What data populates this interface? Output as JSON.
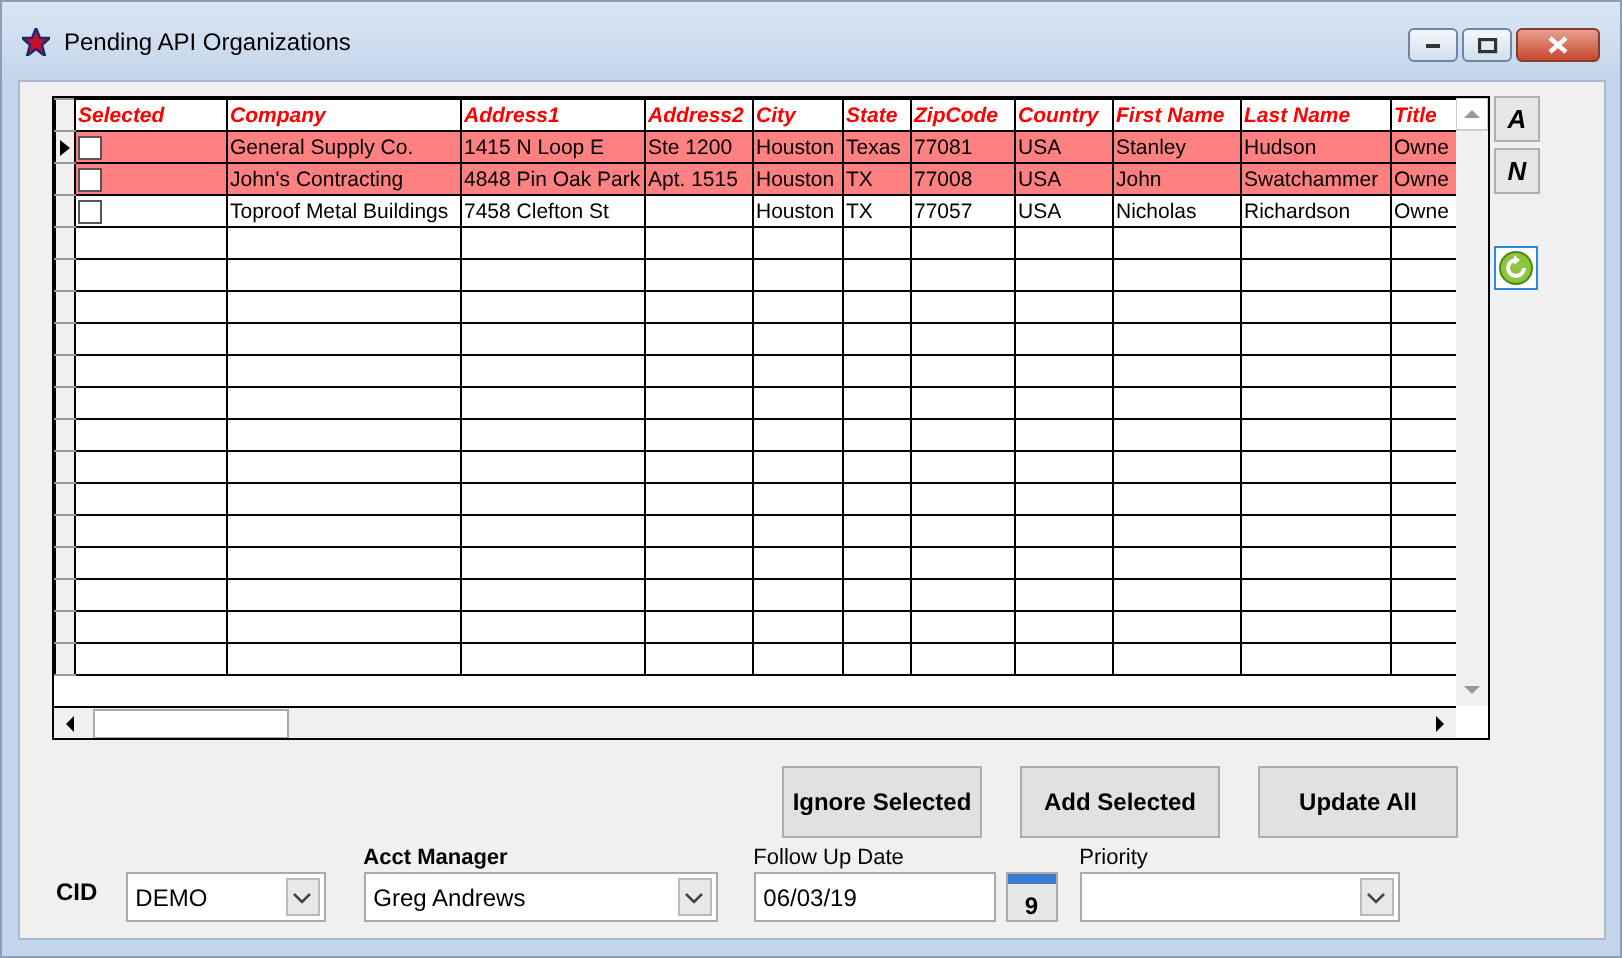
{
  "window": {
    "title": "Pending API Organizations"
  },
  "grid": {
    "checkbox_column": "Selected",
    "columns": [
      "Company",
      "Address1",
      "Address2",
      "City",
      "State",
      "ZipCode",
      "Country",
      "First Name",
      "Last Name",
      "Title"
    ],
    "rows": [
      {
        "current": true,
        "highlighted": true,
        "checked": false,
        "cells": [
          "General Supply Co.",
          "1415 N Loop E",
          "Ste 1200",
          "Houston",
          "Texas",
          "77081",
          "USA",
          "Stanley",
          "Hudson",
          "Owne"
        ]
      },
      {
        "current": false,
        "highlighted": true,
        "checked": false,
        "cells": [
          "John's Contracting",
          "4848 Pin Oak Park",
          "Apt. 1515",
          "Houston",
          "TX",
          "77008",
          "USA",
          "John",
          "Swatchammer",
          "Owne"
        ]
      },
      {
        "current": false,
        "highlighted": false,
        "checked": false,
        "cells": [
          "Toproof Metal Buildings",
          "7458 Clefton St",
          "",
          "Houston",
          "TX",
          "77057",
          "USA",
          "Nicholas",
          "Richardson",
          "Owne"
        ]
      }
    ]
  },
  "side_buttons": [
    "A",
    "N"
  ],
  "actions": [
    "Ignore Selected",
    "Add Selected",
    "Update All"
  ],
  "form": {
    "cid": {
      "label": "CID",
      "value": "DEMO"
    },
    "acct_manager": {
      "label": "Acct Manager",
      "value": "Greg Andrews"
    },
    "follow_up_date": {
      "label": "Follow Up Date",
      "value": "06/03/19",
      "calendar_day": "9"
    },
    "priority": {
      "label": "Priority"
    }
  }
}
